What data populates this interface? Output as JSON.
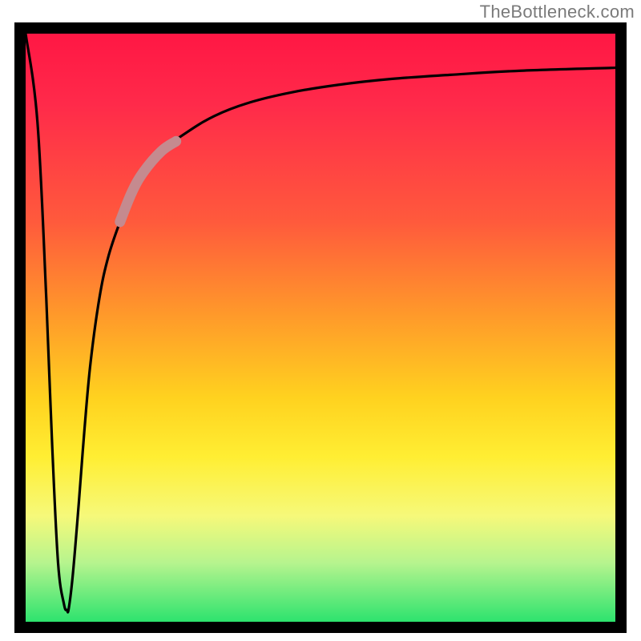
{
  "watermark": "TheBottleneck.com",
  "chart_data": {
    "type": "line",
    "title": "",
    "xlabel": "",
    "ylabel": "",
    "xlim": [
      0,
      100
    ],
    "ylim": [
      0,
      100
    ],
    "grid": false,
    "legend": false,
    "annotations": [],
    "series": [
      {
        "name": "bottleneck-curve",
        "color": "#000000",
        "x": [
          0,
          2,
          3.5,
          4.5,
          5.5,
          6.5,
          7,
          7.3,
          8,
          9,
          10,
          11,
          12.5,
          14,
          16,
          18,
          20,
          23,
          27,
          32,
          38,
          45,
          53,
          62,
          72,
          84,
          100
        ],
        "values": [
          100,
          85,
          55,
          30,
          10,
          3,
          2,
          2.2,
          8,
          20,
          33,
          44,
          55,
          62,
          68,
          73,
          76.5,
          80,
          83,
          86,
          88.3,
          90,
          91.3,
          92.3,
          93,
          93.7,
          94.2
        ]
      },
      {
        "name": "highlight-band",
        "color": "#c58a8f",
        "x": [
          16,
          18,
          20,
          23,
          25.5
        ],
        "values": [
          68,
          73,
          76.5,
          80,
          81.7
        ]
      }
    ],
    "gradient_stops": [
      {
        "pos": 0.0,
        "color": "#ff1744"
      },
      {
        "pos": 0.12,
        "color": "#ff2a4a"
      },
      {
        "pos": 0.32,
        "color": "#ff5a3c"
      },
      {
        "pos": 0.48,
        "color": "#ff9a2a"
      },
      {
        "pos": 0.62,
        "color": "#ffd21f"
      },
      {
        "pos": 0.72,
        "color": "#ffee33"
      },
      {
        "pos": 0.82,
        "color": "#f6f97a"
      },
      {
        "pos": 0.9,
        "color": "#b6f48e"
      },
      {
        "pos": 1.0,
        "color": "#2de36e"
      }
    ]
  }
}
